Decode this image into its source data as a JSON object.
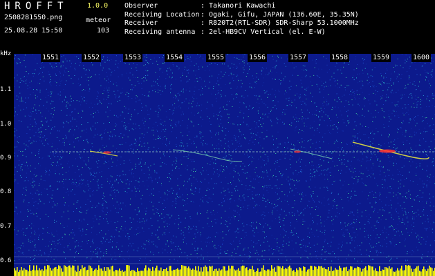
{
  "header": {
    "app_title": "HROFFT",
    "version": "1.0.0",
    "filename": "2508281550.png",
    "mode": "meteor",
    "datetime": "25.08.28 15:50",
    "count": "103"
  },
  "station": [
    {
      "label": "Observer",
      "value": ": Takanori Kawachi"
    },
    {
      "label": "Receiving Location",
      "value": ": Ogaki, Gifu, JAPAN (136.60E, 35.35N)"
    },
    {
      "label": "Receiver",
      "value": ": R820T2(RTL-SDR) SDR-Sharp 53.1000MHz"
    },
    {
      "label": "Receiving antenna",
      "value": ": 2el-HB9CV Vertical (el. E-W)"
    }
  ],
  "axis": {
    "freq_unit": "kHz",
    "freq_ticks": [
      "1.1",
      "1.0",
      "0.9",
      "0.8",
      "0.7",
      "0.6"
    ],
    "time_ticks": [
      "1551",
      "1552",
      "1553",
      "1554",
      "1555",
      "1556",
      "1557",
      "1558",
      "1559",
      "1600"
    ]
  },
  "colors": {
    "background_noise": "#0c1a8c",
    "noise_bright": "#26b4c8",
    "signal": "#e0e040",
    "echo_peak": "#ff3030",
    "baseline_bar": "#ffff00"
  }
}
